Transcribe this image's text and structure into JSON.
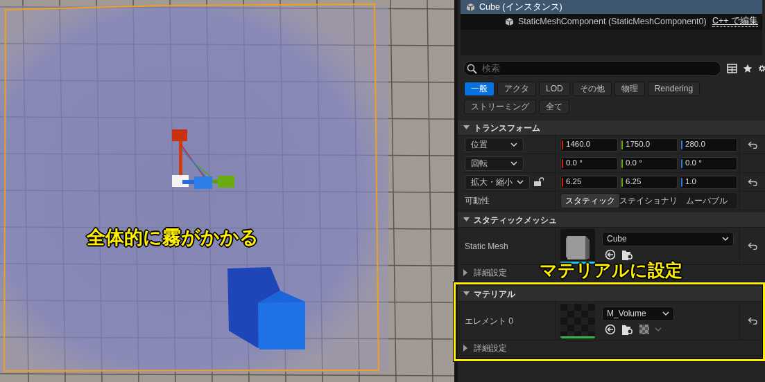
{
  "viewport": {
    "annotation": "全体的に霧がかかる"
  },
  "components": [
    {
      "label": "Cube (インスタンス)",
      "selected": true,
      "children": [
        {
          "label": "StaticMeshComponent (StaticMeshComponent0)",
          "selected": false,
          "action": "C++ で編集"
        }
      ]
    }
  ],
  "search": {
    "placeholder": "検索"
  },
  "filters": [
    {
      "label": "一般",
      "selected": true
    },
    {
      "label": "アクタ",
      "selected": false
    },
    {
      "label": "LOD",
      "selected": false
    },
    {
      "label": "その他",
      "selected": false
    },
    {
      "label": "物理",
      "selected": false
    },
    {
      "label": "Rendering",
      "selected": false
    },
    {
      "label": "ストリーミング",
      "selected": false
    },
    {
      "label": "全て",
      "selected": false
    }
  ],
  "sections": [
    {
      "title": "トランスフォーム",
      "expanded": true,
      "rows": [
        {
          "kind": "vector",
          "label": "位置",
          "reset": true,
          "values": [
            {
              "text": "1460.0",
              "color": "#c8250e"
            },
            {
              "text": "1750.0",
              "color": "#6aa80e"
            },
            {
              "text": "280.0",
              "color": "#2d80e0"
            }
          ]
        },
        {
          "kind": "vector",
          "label": "回転",
          "reset": false,
          "values": [
            {
              "text": "0.0 °",
              "color": "#c8250e"
            },
            {
              "text": "0.0 °",
              "color": "#6aa80e"
            },
            {
              "text": "0.0 °",
              "color": "#2d80e0"
            }
          ]
        },
        {
          "kind": "vector",
          "label": "拡大・縮小",
          "locked": false,
          "reset": true,
          "values": [
            {
              "text": "6.25",
              "color": "#c8250e"
            },
            {
              "text": "6.25",
              "color": "#6aa80e"
            },
            {
              "text": "1.0",
              "color": "#2d80e0"
            }
          ]
        },
        {
          "kind": "segmented",
          "label": "可動性",
          "options": [
            {
              "label": "スタティック",
              "selected": true
            },
            {
              "label": "ステイショナリ",
              "selected": false
            },
            {
              "label": "ムーバブル",
              "selected": false
            }
          ]
        }
      ]
    },
    {
      "title": "スタティックメッシュ",
      "expanded": true,
      "rows": [
        {
          "kind": "mesh_asset",
          "label": "Static Mesh",
          "value": "Cube",
          "color": "#19c8e6",
          "reset": true
        }
      ],
      "advanced": {
        "label": "詳細設定",
        "expanded": false
      }
    },
    {
      "title": "マテリアル",
      "expanded": true,
      "highlighted": true,
      "callout": "マテリアルに設定",
      "rows": [
        {
          "kind": "material_asset",
          "label": "エレメント 0",
          "value": "M_Volume",
          "color": "#2fb84a",
          "reset": true
        }
      ],
      "advanced": {
        "label": "詳細設定",
        "expanded": false
      }
    }
  ]
}
